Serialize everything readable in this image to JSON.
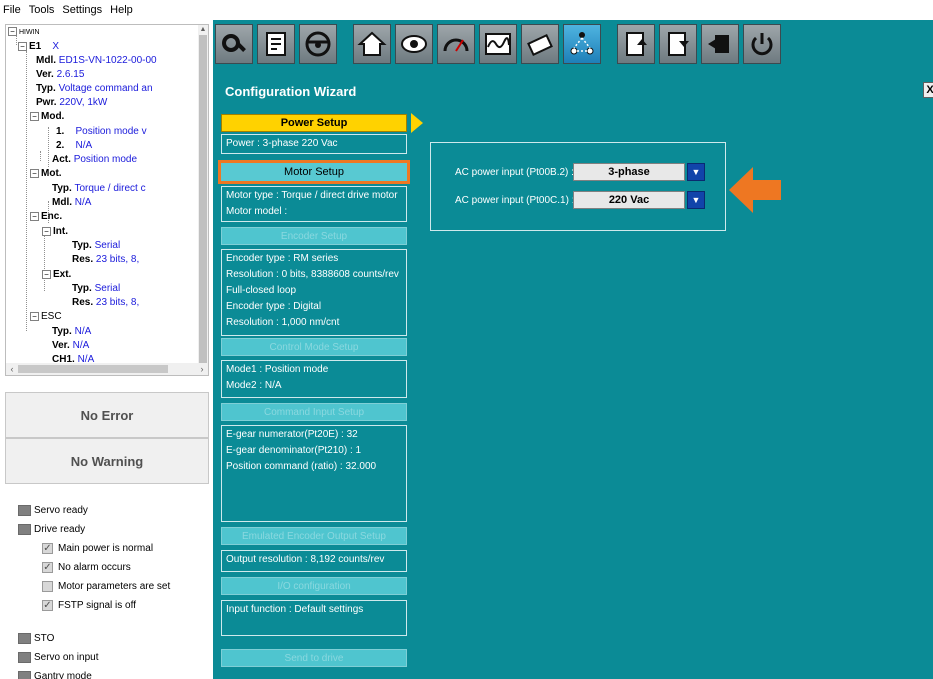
{
  "menu": [
    "File",
    "Tools",
    "Settings",
    "Help"
  ],
  "tree": {
    "root": "HIWIN",
    "e1_label": "E1",
    "e1_close": "X",
    "mdl_k": "Mdl.",
    "mdl_v": "ED1S-VN-1022-00-00",
    "ver_k": "Ver.",
    "ver_v": "2.6.15",
    "typ_k": "Typ.",
    "typ_v": "Voltage command an",
    "pwr_k": "Pwr.",
    "pwr_v": "220V, 1kW",
    "mod_k": "Mod.",
    "mod1_k": "1.",
    "mod1_v": "Position mode v",
    "mod2_k": "2.",
    "mod2_v": "N/A",
    "act_k": "Act.",
    "act_v": "Position mode",
    "mot_k": "Mot.",
    "mot_typ_k": "Typ.",
    "mot_typ_v": "Torque / direct c",
    "mot_mdl_k": "Mdl.",
    "mot_mdl_v": "N/A",
    "enc_k": "Enc.",
    "int_k": "Int.",
    "int_typ_k": "Typ.",
    "int_typ_v": "Serial",
    "int_res_k": "Res.",
    "int_res_v": "23 bits, 8,",
    "ext_k": "Ext.",
    "ext_typ_k": "Typ.",
    "ext_typ_v": "Serial",
    "ext_res_k": "Res.",
    "ext_res_v": "23 bits, 8,",
    "esc_k": "ESC",
    "esc_typ_k": "Typ.",
    "esc_typ_v": "N/A",
    "esc_ver_k": "Ver.",
    "esc_ver_v": "N/A",
    "esc_ch1_k": "CH1.",
    "esc_ch1_v": "N/A"
  },
  "status": {
    "error": "No Error",
    "warning": "No Warning"
  },
  "indicators": {
    "servo_ready": "Servo ready",
    "drive_ready": "Drive ready",
    "main_power": "Main power is normal",
    "no_alarm": "No alarm occurs",
    "motor_params": "Motor parameters are set",
    "fstp": "FSTP signal is off",
    "sto": "STO",
    "servo_on": "Servo on input",
    "gantry": "Gantry mode"
  },
  "toolbar_icons": [
    "gear-wrench-icon",
    "document-edit-icon",
    "steering-wheel-icon",
    "home-icon",
    "eye-icon",
    "gauge-icon",
    "waveform-icon",
    "tools-icon",
    "configuration-wizard-icon",
    "export-document-icon",
    "import-document-icon",
    "firmware-icon",
    "reset-icon"
  ],
  "wizard": {
    "title": "Configuration Wizard",
    "close": "X",
    "steps": {
      "power": "Power Setup",
      "motor": "Motor Setup",
      "encoder": "Encoder Setup",
      "control": "Control Mode Setup",
      "command": "Command Input Setup",
      "emulated": "Emulated Encoder Output Setup",
      "io": "I/O configuration",
      "send": "Send to drive"
    },
    "info": {
      "power": [
        "Power : 3-phase 220 Vac"
      ],
      "motor": [
        "Motor type : Torque / direct drive motor",
        "Motor model  :"
      ],
      "encoder": [
        "Encoder type : RM series",
        "Resolution : 0 bits, 8388608 counts/rev",
        "Full-closed loop",
        "Encoder type : Digital",
        "Resolution : 1,000 nm/cnt"
      ],
      "control": [
        "Mode1 : Position mode",
        "Mode2 : N/A"
      ],
      "command": [
        "E-gear numerator(Pt20E) : 32",
        "E-gear denominator(Pt210) : 1",
        "Position command (ratio) : 32.000"
      ],
      "emulated": [
        "Output resolution : 8,192 counts/rev"
      ],
      "io": [
        "Input function : Default settings"
      ]
    },
    "settings": {
      "row1_label": "AC power input (Pt00B.2) :",
      "row1_value": "3-phase",
      "row2_label": "AC power input (Pt00C.1) :",
      "row2_value": "220 Vac",
      "dropdown_glyph": "▼"
    }
  },
  "colors": {
    "teal": "#0b8b96",
    "power_step": "#ffd200",
    "highlight_orange": "#ee7722",
    "dropdown_blue": "#1144aa"
  }
}
